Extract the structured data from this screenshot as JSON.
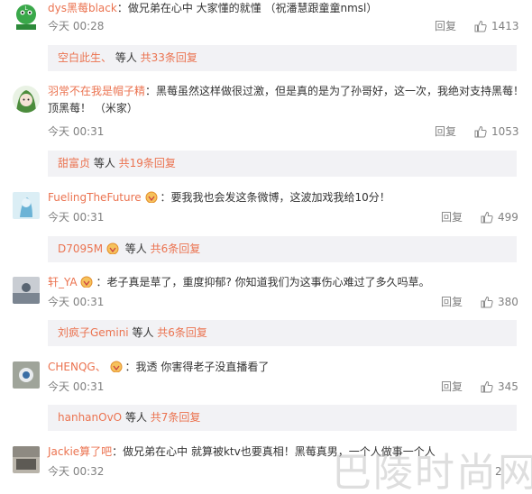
{
  "comments": [
    {
      "user": "dys黑莓black",
      "text": "：做兄弟在心中 大家懂的就懂 （祝潘慧跟童童nmsl）",
      "time": "今天 00:28",
      "reply_label": "回复",
      "likes": "1413",
      "sub": {
        "user": "空白此生、",
        "mid": " 等人 ",
        "count": "共33条回复"
      }
    },
    {
      "user": "羽常不在我是帽子精",
      "text": "：黑莓虽然这样做很过激，但是真的是为了孙哥好，这一次，我绝对支持黑莓！顶黑莓！ （米家）",
      "time": "今天 00:31",
      "reply_label": "回复",
      "likes": "1053",
      "sub": {
        "user": "甜富贞",
        "mid": " 等人 ",
        "count": "共19条回复"
      }
    },
    {
      "user": "FuelingTheFuture",
      "text": "：要我我也会发这条微博，这波加戏我给10分！",
      "time": "今天 00:31",
      "reply_label": "回复",
      "likes": "499",
      "sub": {
        "user": "D7095M",
        "mid": " 等人 ",
        "count": "共6条回复"
      }
    },
    {
      "user": "轩_YA",
      "text": "：老子真是草了，重度抑郁? 你知道我们为这事伤心难过了多久吗草。",
      "time": "今天 00:31",
      "reply_label": "回复",
      "likes": "380",
      "sub": {
        "user": "刘疯子Gemini",
        "mid": " 等人 ",
        "count": "共6条回复"
      }
    },
    {
      "user": "CHENQG、",
      "text": "：我透 你害得老子没直播看了",
      "time": "今天 00:31",
      "reply_label": "回复",
      "likes": "345",
      "sub": {
        "user": "hanhanOvO",
        "mid": " 等人 ",
        "count": "共7条回复"
      }
    },
    {
      "user": "Jackie算了吧",
      "text": "：做兄弟在心中 就算被ktv也要真相！黑莓真男，一个人做事一个人",
      "time": "今天 00:32",
      "reply_label": "回复",
      "likes": "2"
    }
  ],
  "watermark": "巴陵时尚网",
  "colors": {
    "username": "#eb7350",
    "meta": "#808080",
    "subbox_bg": "#f2f2f5"
  },
  "icons": [
    "thumbs-up-icon",
    "vip-badge-icon"
  ]
}
